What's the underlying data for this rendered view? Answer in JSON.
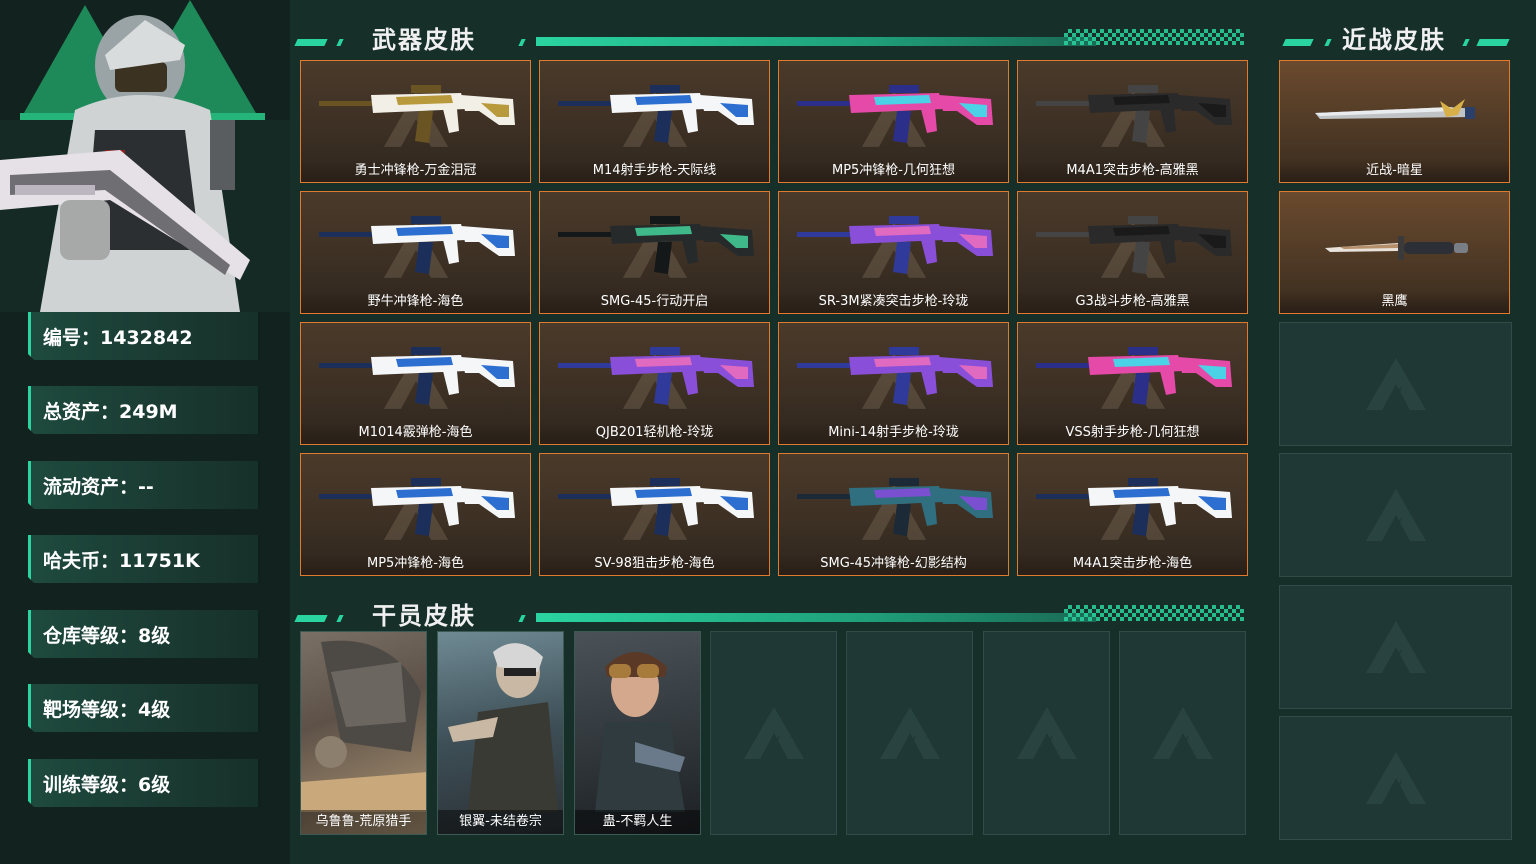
{
  "stats": [
    {
      "label": "编号",
      "value": "1432842"
    },
    {
      "label": "总资产",
      "value": "249M"
    },
    {
      "label": "流动资产",
      "value": "--"
    },
    {
      "label": "哈夫币",
      "value": "11751K"
    },
    {
      "label": "仓库等级",
      "value": "8级"
    },
    {
      "label": "靶场等级",
      "value": "4级"
    },
    {
      "label": "训练等级",
      "value": "6级"
    }
  ],
  "stat_text": [
    "编号：1432842",
    "总资产：249M",
    "流动资产：--",
    "哈夫币：11751K",
    "仓库等级：8级",
    "靶场等级：4级",
    "训练等级：6级"
  ],
  "sections": {
    "weapons": "武器皮肤",
    "melee": "近战皮肤",
    "operators": "干员皮肤"
  },
  "weapons": [
    {
      "name": "勇士冲锋枪-万金泪冠",
      "palette": "gold"
    },
    {
      "name": "M14射手步枪-天际线",
      "palette": "white-blue"
    },
    {
      "name": "MP5冲锋枪-几何狂想",
      "palette": "pink-cyan"
    },
    {
      "name": "M4A1突击步枪-高雅黑",
      "palette": "black"
    },
    {
      "name": "野牛冲锋枪-海色",
      "palette": "white-blue"
    },
    {
      "name": "SMG-45-行动开启",
      "palette": "black-green"
    },
    {
      "name": "SR-3M紧凑突击步枪-玲珑",
      "palette": "purple"
    },
    {
      "name": "G3战斗步枪-高雅黑",
      "palette": "black"
    },
    {
      "name": "M1014霰弹枪-海色",
      "palette": "white-blue"
    },
    {
      "name": "QJB201轻机枪-玲珑",
      "palette": "purple"
    },
    {
      "name": "Mini-14射手步枪-玲珑",
      "palette": "purple"
    },
    {
      "name": "VSS射手步枪-几何狂想",
      "palette": "pink-cyan"
    },
    {
      "name": "MP5冲锋枪-海色",
      "palette": "white-blue"
    },
    {
      "name": "SV-98狙击步枪-海色",
      "palette": "white-blue"
    },
    {
      "name": "SMG-45冲锋枪-幻影结构",
      "palette": "teal-purple"
    },
    {
      "name": "M4A1突击步枪-海色",
      "palette": "white-blue"
    }
  ],
  "melee": [
    {
      "name": "近战-暗星"
    },
    {
      "name": "黑鹰"
    }
  ],
  "operators": [
    {
      "name": "乌鲁鲁-荒原猎手"
    },
    {
      "name": "银翼-未结卷宗"
    },
    {
      "name": "蛊-不羁人生"
    }
  ],
  "colors": {
    "accent": "#2ad4a0",
    "card_border": "#e07a2e",
    "background": "#163029"
  }
}
